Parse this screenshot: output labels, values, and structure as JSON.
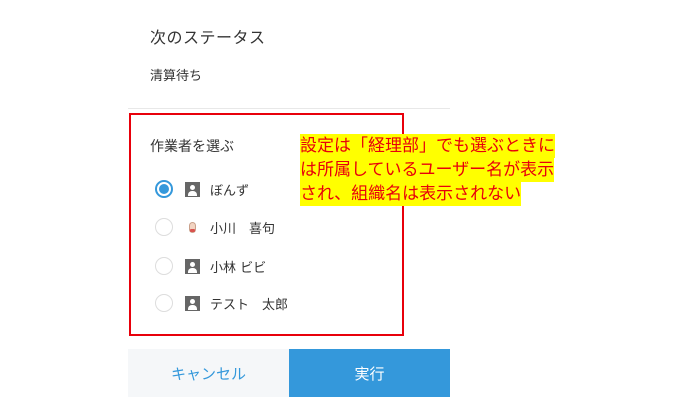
{
  "status": {
    "heading": "次のステータス",
    "value": "清算待ち"
  },
  "assignee": {
    "title": "作業者を選ぶ",
    "options": [
      {
        "label": "ぼんず",
        "icon": "user-icon",
        "selected": true
      },
      {
        "label": "小川　喜句",
        "icon": "user-photo-icon",
        "selected": false
      },
      {
        "label": "小林 ビビ",
        "icon": "user-icon",
        "selected": false
      },
      {
        "label": "テスト　太郎",
        "icon": "user-icon",
        "selected": false
      }
    ]
  },
  "annotation": {
    "lines": [
      "設定は「経理部」でも選ぶときに",
      "は所属しているユーザー名が表示",
      "され、組織名は表示されない"
    ],
    "text_color": "#e8000b",
    "highlight_color": "#ffff00"
  },
  "buttons": {
    "cancel_label": "キャンセル",
    "execute_label": "実行"
  },
  "colors": {
    "accent": "#3498db",
    "highlight_box": "#e8000b"
  }
}
